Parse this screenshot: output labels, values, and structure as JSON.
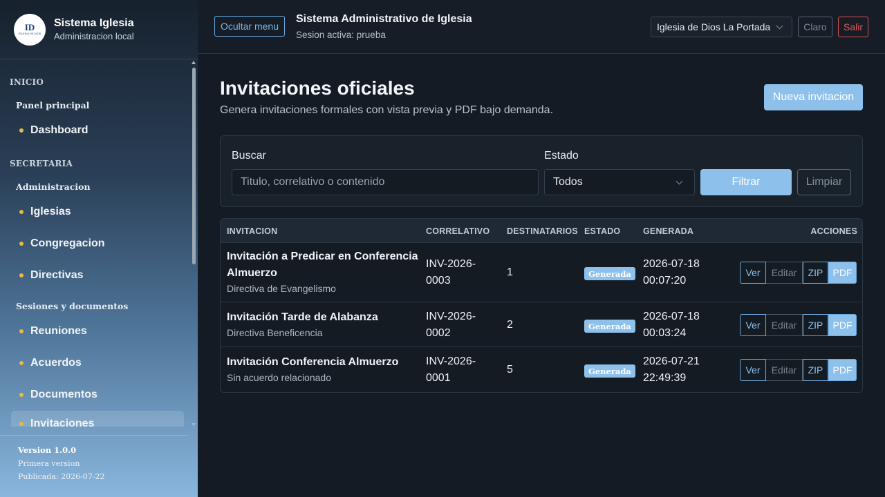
{
  "brand": {
    "logo_text": "ID",
    "logo_subtext": "IGLESIA DE DIOS",
    "title": "Sistema Iglesia",
    "subtitle": "Administracion local"
  },
  "sidebar": {
    "sections": [
      {
        "label": "INICIO",
        "groups": [
          {
            "label": "Panel principal",
            "items": [
              "Dashboard"
            ]
          }
        ]
      },
      {
        "label": "SECRETARIA",
        "groups": [
          {
            "label": "Administracion",
            "items": [
              "Iglesias",
              "Congregacion",
              "Directivas"
            ]
          },
          {
            "label": "Sesiones y documentos",
            "items": [
              "Reuniones",
              "Acuerdos",
              "Documentos",
              "Invitaciones"
            ]
          }
        ]
      }
    ],
    "active_item": "Invitaciones",
    "version": {
      "title": "Version 1.0.0",
      "note": "Primera version",
      "published": "Publicada: 2026-07-22"
    }
  },
  "topbar": {
    "toggle_menu_label": "Ocultar menu",
    "title": "Sistema Administrativo de Iglesia",
    "session": "Sesion activa: prueba",
    "church_selected": "Iglesia de Dios La Portada",
    "theme_label": "Claro",
    "logout_label": "Salir"
  },
  "page": {
    "title": "Invitaciones oficiales",
    "subtitle": "Genera invitaciones formales con vista previa y PDF bajo demanda.",
    "new_button": "Nueva invitacion"
  },
  "filters": {
    "search_label": "Buscar",
    "search_placeholder": "Titulo, correlativo o contenido",
    "status_label": "Estado",
    "status_selected": "Todos",
    "filter_button": "Filtrar",
    "clear_button": "Limpiar"
  },
  "table": {
    "headers": {
      "invitation": "INVITACION",
      "correlative": "CORRELATIVO",
      "recipients": "DESTINATARIOS",
      "status": "ESTADO",
      "generated": "GENERADA",
      "actions": "ACCIONES"
    },
    "action_labels": {
      "view": "Ver",
      "edit": "Editar",
      "zip": "ZIP",
      "pdf": "PDF"
    },
    "rows": [
      {
        "title_line1": "Invitación a Predicar en Conferencia",
        "title_line2": "Almuerzo",
        "subtitle": "Directiva de Evangelismo",
        "correlative_line1": "INV-2026-",
        "correlative_line2": "0003",
        "recipients": "1",
        "status": "Generada",
        "date": "2026-07-18",
        "time": "00:07:20"
      },
      {
        "title_line1": "Invitación Tarde de Alabanza",
        "title_line2": "",
        "subtitle": "Directiva Beneficencia",
        "correlative_line1": "INV-2026-",
        "correlative_line2": "0002",
        "recipients": "2",
        "status": "Generada",
        "date": "2026-07-18",
        "time": "00:03:24"
      },
      {
        "title_line1": "Invitación Conferencia Almuerzo",
        "title_line2": "",
        "subtitle": "Sin acuerdo relacionado",
        "correlative_line1": "INV-2026-",
        "correlative_line2": "0001",
        "recipients": "5",
        "status": "Generada",
        "date": "2026-07-21",
        "time": "22:49:39"
      }
    ]
  },
  "colors": {
    "accent": "#8ec0ec",
    "danger": "#e05a55",
    "bullet": "#e8b94a",
    "background": "#141b24"
  }
}
